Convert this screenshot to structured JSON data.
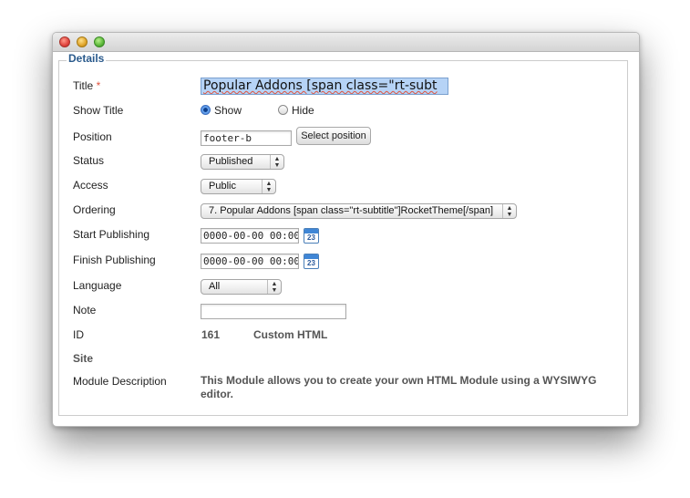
{
  "legend": "Details",
  "fields": {
    "title": {
      "label": "Title",
      "required": "*",
      "value": "Popular Addons [span class=\"rt-subt"
    },
    "show_title": {
      "label": "Show Title",
      "options": [
        "Show",
        "Hide"
      ],
      "selected": "Show"
    },
    "position": {
      "label": "Position",
      "value": "footer-b",
      "button": "Select position"
    },
    "status": {
      "label": "Status",
      "value": "Published"
    },
    "access": {
      "label": "Access",
      "value": "Public"
    },
    "ordering": {
      "label": "Ordering",
      "value": "7. Popular Addons [span class=\"rt-subtitle\"]RocketTheme[/span]"
    },
    "start_publishing": {
      "label": "Start Publishing",
      "value": "0000-00-00 00:00:0",
      "calendar_day": "23"
    },
    "finish_publishing": {
      "label": "Finish Publishing",
      "value": "0000-00-00 00:00:0",
      "calendar_day": "23"
    },
    "language": {
      "label": "Language",
      "value": "All"
    },
    "note": {
      "label": "Note",
      "value": ""
    },
    "id": {
      "label": "ID",
      "value": "161",
      "type": "Custom HTML"
    },
    "site": {
      "label": "Site"
    },
    "module_description": {
      "label": "Module Description",
      "value": "This Module allows you to create your own HTML Module using a WYSIWYG editor."
    }
  },
  "icons": {
    "close": "close-icon",
    "minimize": "minimize-icon",
    "zoom": "zoom-icon",
    "calendar": "calendar-icon",
    "select_arrows": "chevron-up-down-icon"
  },
  "colors": {
    "legend": "#2a5a8c",
    "required": "#e0533e",
    "title_highlight": "#b6d3f6",
    "radio_selected": "#3d7fd9"
  }
}
